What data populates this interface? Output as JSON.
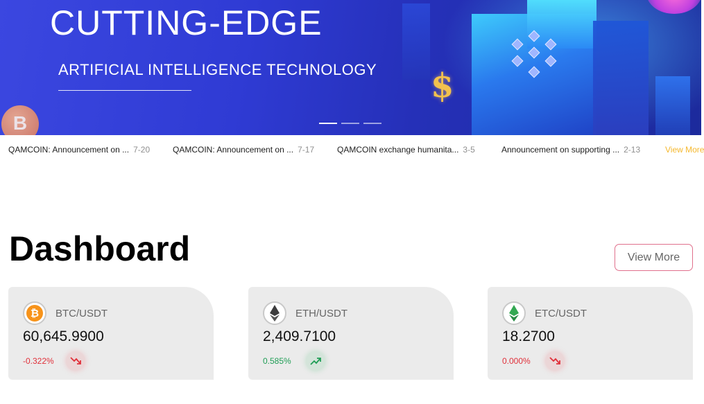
{
  "banner": {
    "title": "CUTTING-EDGE",
    "subtitle": "ARTIFICIAL INTELLIGENCE TECHNOLOGY",
    "coin_symbol": "B",
    "dollar_symbol": "$",
    "slide_count": 3,
    "active_slide": 1
  },
  "notices": [
    {
      "title": "QAMCOIN: Announcement on ...",
      "date": "7-20"
    },
    {
      "title": "QAMCOIN: Announcement on ...",
      "date": "7-17"
    },
    {
      "title": "QAMCOIN exchange humanita...",
      "date": "3-5"
    },
    {
      "title": "Announcement on supporting ...",
      "date": "2-13"
    }
  ],
  "notice_view_more": "View More",
  "dashboard": {
    "title": "Dashboard",
    "view_more": "View More",
    "cards": [
      {
        "pair": "BTC/USDT",
        "price": "60,645.9900",
        "change": "-0.322%",
        "direction": "down",
        "icon": "bitcoin-icon",
        "color": "#f7931a"
      },
      {
        "pair": "ETH/USDT",
        "price": "2,409.7100",
        "change": "0.585%",
        "direction": "up",
        "icon": "ethereum-icon",
        "color": "#3c3c3d"
      },
      {
        "pair": "ETC/USDT",
        "price": "18.2700",
        "change": "0.000%",
        "direction": "down",
        "icon": "ethereum-classic-icon",
        "color": "#33a852"
      }
    ]
  },
  "colors": {
    "accent_yellow": "#f5b82e",
    "down_red": "#e0303a",
    "up_green": "#1f9d55",
    "button_border": "#e0708c"
  }
}
